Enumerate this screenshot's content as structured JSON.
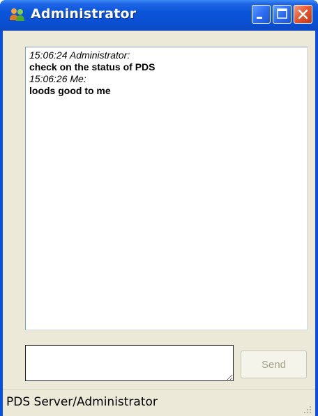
{
  "window": {
    "title": "Administrator"
  },
  "icons": {
    "app": "users-icon",
    "minimize": "minimize-icon",
    "maximize": "maximize-icon",
    "close": "close-icon",
    "grip": "resize-grip-icon"
  },
  "colors": {
    "titlebar": "#0a55d9",
    "client": "#ece9d8",
    "close_button": "#e5542f"
  },
  "chat": {
    "messages": [
      {
        "meta": "15:06:24 Administrator:",
        "text": "check on the status of PDS"
      },
      {
        "meta": "15:06:26 Me:",
        "text": "loods good to me"
      }
    ]
  },
  "compose": {
    "value": "",
    "send_label": "Send",
    "send_enabled": false
  },
  "status": {
    "text": "PDS Server/Administrator"
  }
}
